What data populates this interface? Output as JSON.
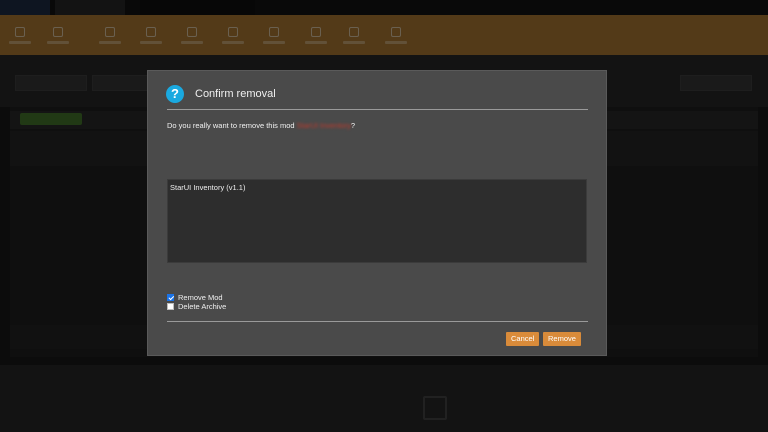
{
  "dialog": {
    "title": "Confirm removal",
    "question_prefix": "Do you really want to remove this mod",
    "question_modname": "StarUI Inventory",
    "question_suffix": "?",
    "list_items": [
      "StarUI Inventory (v1.1)"
    ],
    "options": [
      {
        "label": "Remove Mod",
        "checked": true
      },
      {
        "label": "Delete Archive",
        "checked": false
      }
    ],
    "buttons": {
      "cancel": "Cancel",
      "remove": "Remove"
    }
  },
  "colors": {
    "accent": "#d98b3a",
    "toolbar": "#b98136",
    "help_icon": "#1aa9e0",
    "mod_name": "#c0392b",
    "checkbox": "#1a73e8"
  },
  "icons": {
    "help": "question-circle-icon"
  }
}
